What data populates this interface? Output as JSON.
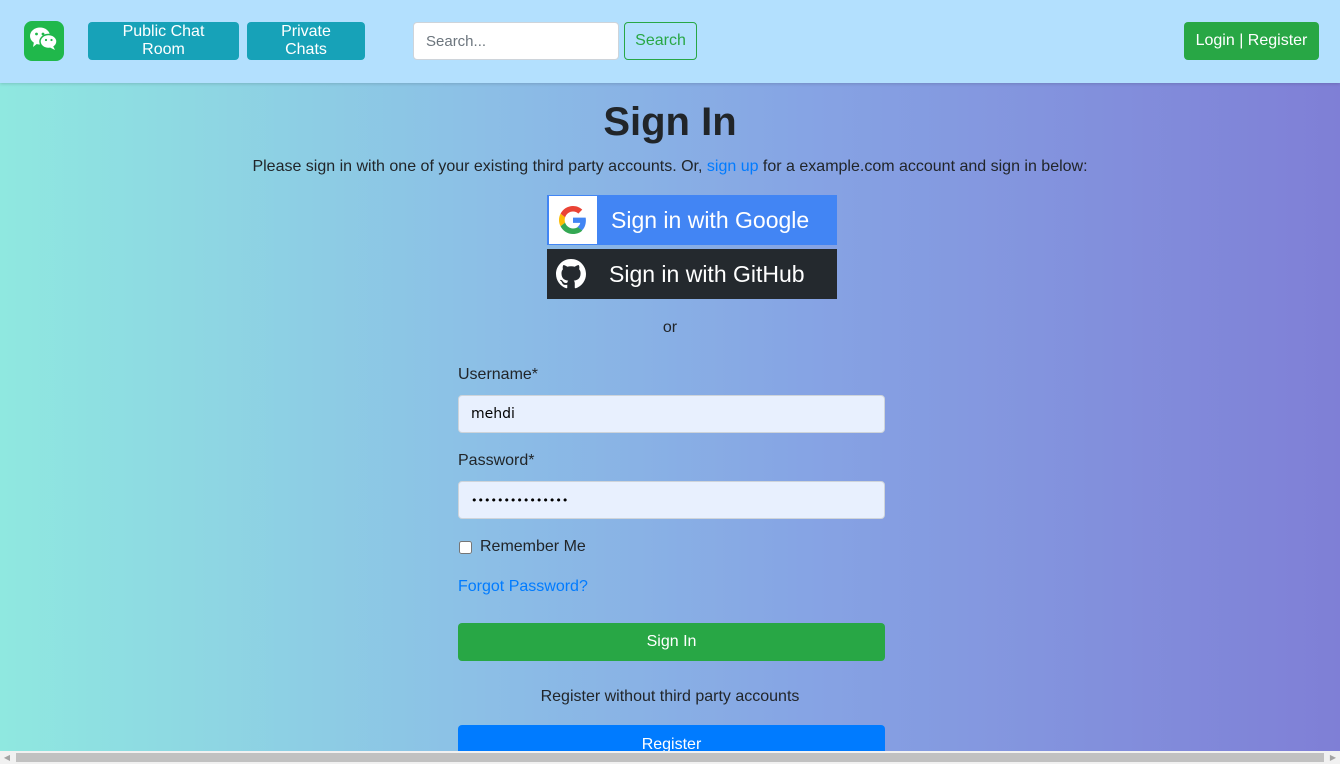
{
  "navbar": {
    "logo_icon": "wechat-icon",
    "public_chat_label": "Public Chat Room",
    "private_chats_label": "Private Chats",
    "search_placeholder": "Search...",
    "search_button_label": "Search",
    "login_register_label": "Login | Register"
  },
  "signin": {
    "title": "Sign In",
    "intro_before": "Please sign in with one of your existing third party accounts. Or, ",
    "intro_link": "sign up",
    "intro_after": " for a example.com account and sign in below:",
    "google_label": "Sign in with Google",
    "github_label": "Sign in with GitHub",
    "or_text": "or",
    "username_label": "Username*",
    "username_value": "mehdi",
    "password_label": "Password*",
    "password_value": "•••••••••••••••",
    "remember_label": "Remember Me",
    "remember_checked": false,
    "forgot_label": "Forgot Password?",
    "signin_button": "Sign In",
    "register_note": "Register without third party accounts",
    "register_button": "Register"
  },
  "colors": {
    "navbar_bg": "#b3e0fe",
    "teal": "#17a2b8",
    "green": "#28a745",
    "blue": "#007bff",
    "google_blue": "#4285f4",
    "github_dark": "#24292e"
  }
}
